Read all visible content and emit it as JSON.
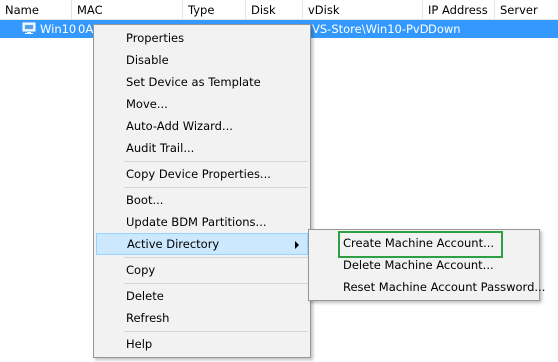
{
  "columns": [
    "Name",
    "MAC",
    "Type",
    "Disk",
    "vDisk",
    "IP Address",
    "Server"
  ],
  "row": {
    "name": "Win10",
    "mac": "0A",
    "vdisk": "VS-Store\\Win10-PvD",
    "ip_address": "Down"
  },
  "context_menu": {
    "items": [
      "Properties",
      "Disable",
      "Set Device as Template",
      "Move...",
      "Auto-Add Wizard...",
      "Audit Trail...",
      "Copy Device Properties...",
      "Boot...",
      "Update BDM Partitions...",
      "Active Directory",
      "Copy",
      "Delete",
      "Refresh",
      "Help"
    ]
  },
  "submenu": {
    "items": [
      "Create Machine Account...",
      "Delete Machine Account...",
      "Reset Machine Account Password..."
    ]
  },
  "colors": {
    "row_selected": "#3399ff",
    "menu_highlight": "#cce8ff",
    "annotation_box": "#2ea043"
  }
}
